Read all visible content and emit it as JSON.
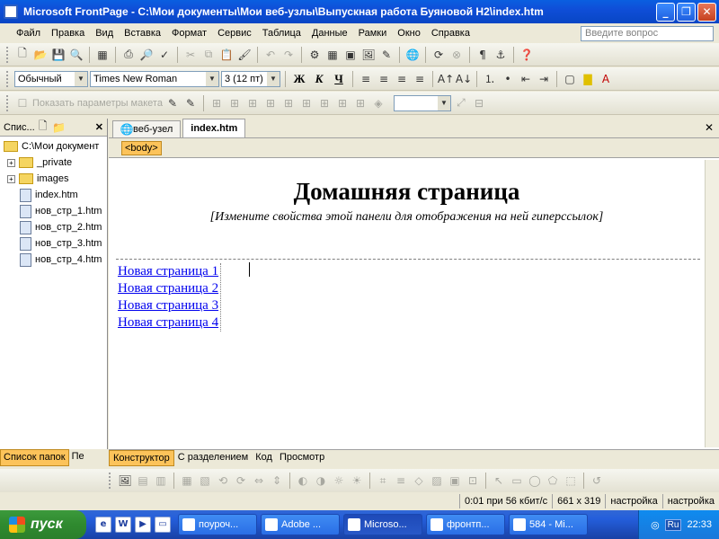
{
  "window": {
    "title": "Microsoft FrontPage - C:\\Мои документы\\Мои веб-узлы\\Выпускная работа Буяновой Н2\\index.htm",
    "buttons": {
      "minimize": "_",
      "restore": "❐",
      "close": "✕"
    }
  },
  "menu": {
    "items": [
      "Файл",
      "Правка",
      "Вид",
      "Вставка",
      "Формат",
      "Сервис",
      "Таблица",
      "Данные",
      "Рамки",
      "Окно",
      "Справка"
    ],
    "ask_placeholder": "Введите вопрос"
  },
  "formatting": {
    "style": "Обычный",
    "font": "Times New Roman",
    "size": "3  (12 пт)",
    "bold": "Ж",
    "italic": "К",
    "underline": "Ч"
  },
  "layout_toolbar": {
    "show_params": "Показать параметры макета"
  },
  "left_panel": {
    "title": "Спис...",
    "close": "✕",
    "root": "C:\\Мои документ",
    "items": [
      {
        "label": "_private",
        "type": "folder",
        "expand": "+"
      },
      {
        "label": "images",
        "type": "folder",
        "expand": "+"
      },
      {
        "label": "index.htm",
        "type": "file"
      },
      {
        "label": "нов_стр_1.htm",
        "type": "file"
      },
      {
        "label": "нов_стр_2.htm",
        "type": "file"
      },
      {
        "label": "нов_стр_3.htm",
        "type": "file"
      },
      {
        "label": "нов_стр_4.htm",
        "type": "file"
      }
    ],
    "tabs": [
      "Список папок",
      "Пе"
    ]
  },
  "doc_tabs": {
    "tabs": [
      "веб-узел",
      "index.htm"
    ],
    "close": "✕"
  },
  "quick_tag": "<body>",
  "page": {
    "heading": "Домашняя страница",
    "nav_note": "[Измените свойства этой панели для отображения на ней гиперссылок]",
    "links": [
      "Новая страница 1",
      "Новая страница 2",
      "Новая страница 3",
      "Новая страница 4"
    ]
  },
  "view_tabs": [
    "Конструктор",
    "С разделением",
    "Код",
    "Просмотр"
  ],
  "status": {
    "speed": "0:01 при 56 кбит/с",
    "size": "661 x 319",
    "mode1": "настройка",
    "mode2": "настройка"
  },
  "taskbar": {
    "start": "пуск",
    "tasks": [
      "поуроч...",
      "Adobe ...",
      "Microso...",
      "фронтп...",
      "584 - Mi..."
    ],
    "lang": "Ru",
    "clock": "22:33"
  }
}
